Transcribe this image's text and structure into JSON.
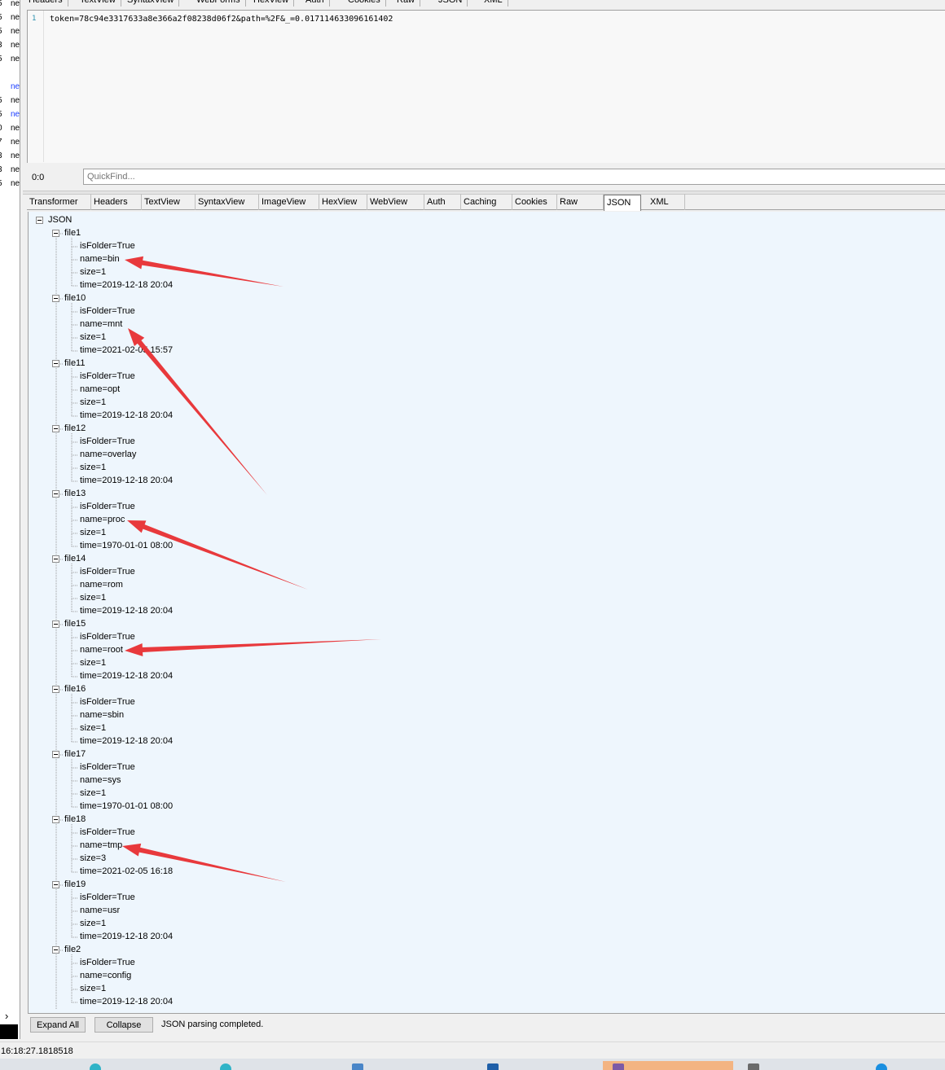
{
  "request": {
    "tabs": [
      "Headers",
      "TextView",
      "SyntaxView",
      "WebForms",
      "HexView",
      "Auth",
      "Cookies",
      "Raw",
      "JSON",
      "XML"
    ],
    "line_number": "1",
    "body": "token=78c94e3317633a8e366a2f08238d06f2&path=%2F&_=0.017114633096161402",
    "caret_position": "0:0",
    "quickfind_placeholder": "QuickFind..."
  },
  "left_strip": {
    "rows": [
      {
        "a": "5",
        "b": "ne",
        "blue": false
      },
      {
        "a": "5",
        "b": "ne",
        "blue": false
      },
      {
        "a": "5",
        "b": "ne",
        "blue": false
      },
      {
        "a": "3",
        "b": "ne",
        "blue": false
      },
      {
        "a": "5",
        "b": "ne",
        "blue": false
      },
      {
        "a": "",
        "b": "",
        "blue": false
      },
      {
        "a": "",
        "b": "ne",
        "blue": true
      },
      {
        "a": "5",
        "b": "ne",
        "blue": false
      },
      {
        "a": "5",
        "b": "ne",
        "blue": true
      },
      {
        "a": "0",
        "b": "ne",
        "blue": false
      },
      {
        "a": "7",
        "b": "ne",
        "blue": false
      },
      {
        "a": "3",
        "b": "ne",
        "blue": false
      },
      {
        "a": "3",
        "b": "ne",
        "blue": false
      },
      {
        "a": "5",
        "b": "ne",
        "blue": false
      }
    ]
  },
  "response": {
    "tabs": [
      "Transformer",
      "Headers",
      "TextView",
      "SyntaxView",
      "ImageView",
      "HexView",
      "WebView",
      "Auth",
      "Caching",
      "Cookies",
      "Raw",
      "JSON",
      "XML"
    ],
    "active_tab": "JSON",
    "tree": {
      "root": "JSON",
      "nodes": [
        {
          "key": "file1",
          "props": [
            "isFolder=True",
            "name=bin",
            "size=1",
            "time=2019-12-18 20:04"
          ]
        },
        {
          "key": "file10",
          "props": [
            "isFolder=True",
            "name=mnt",
            "size=1",
            "time=2021-02-05 15:57"
          ]
        },
        {
          "key": "file11",
          "props": [
            "isFolder=True",
            "name=opt",
            "size=1",
            "time=2019-12-18 20:04"
          ]
        },
        {
          "key": "file12",
          "props": [
            "isFolder=True",
            "name=overlay",
            "size=1",
            "time=2019-12-18 20:04"
          ]
        },
        {
          "key": "file13",
          "props": [
            "isFolder=True",
            "name=proc",
            "size=1",
            "time=1970-01-01 08:00"
          ]
        },
        {
          "key": "file14",
          "props": [
            "isFolder=True",
            "name=rom",
            "size=1",
            "time=2019-12-18 20:04"
          ]
        },
        {
          "key": "file15",
          "props": [
            "isFolder=True",
            "name=root",
            "size=1",
            "time=2019-12-18 20:04"
          ]
        },
        {
          "key": "file16",
          "props": [
            "isFolder=True",
            "name=sbin",
            "size=1",
            "time=2019-12-18 20:04"
          ]
        },
        {
          "key": "file17",
          "props": [
            "isFolder=True",
            "name=sys",
            "size=1",
            "time=1970-01-01 08:00"
          ]
        },
        {
          "key": "file18",
          "props": [
            "isFolder=True",
            "name=tmp",
            "size=3",
            "time=2021-02-05 16:18"
          ]
        },
        {
          "key": "file19",
          "props": [
            "isFolder=True",
            "name=usr",
            "size=1",
            "time=2019-12-18 20:04"
          ]
        },
        {
          "key": "file2",
          "props": [
            "isFolder=True",
            "name=config",
            "size=1",
            "time=2019-12-18 20:04"
          ]
        }
      ]
    },
    "annotation_color": "#e8393c"
  },
  "bottom": {
    "expand_all": "Expand All",
    "collapse": "Collapse",
    "status": "JSON parsing completed."
  },
  "statusbar": {
    "time": "16:18:27.1818518"
  }
}
